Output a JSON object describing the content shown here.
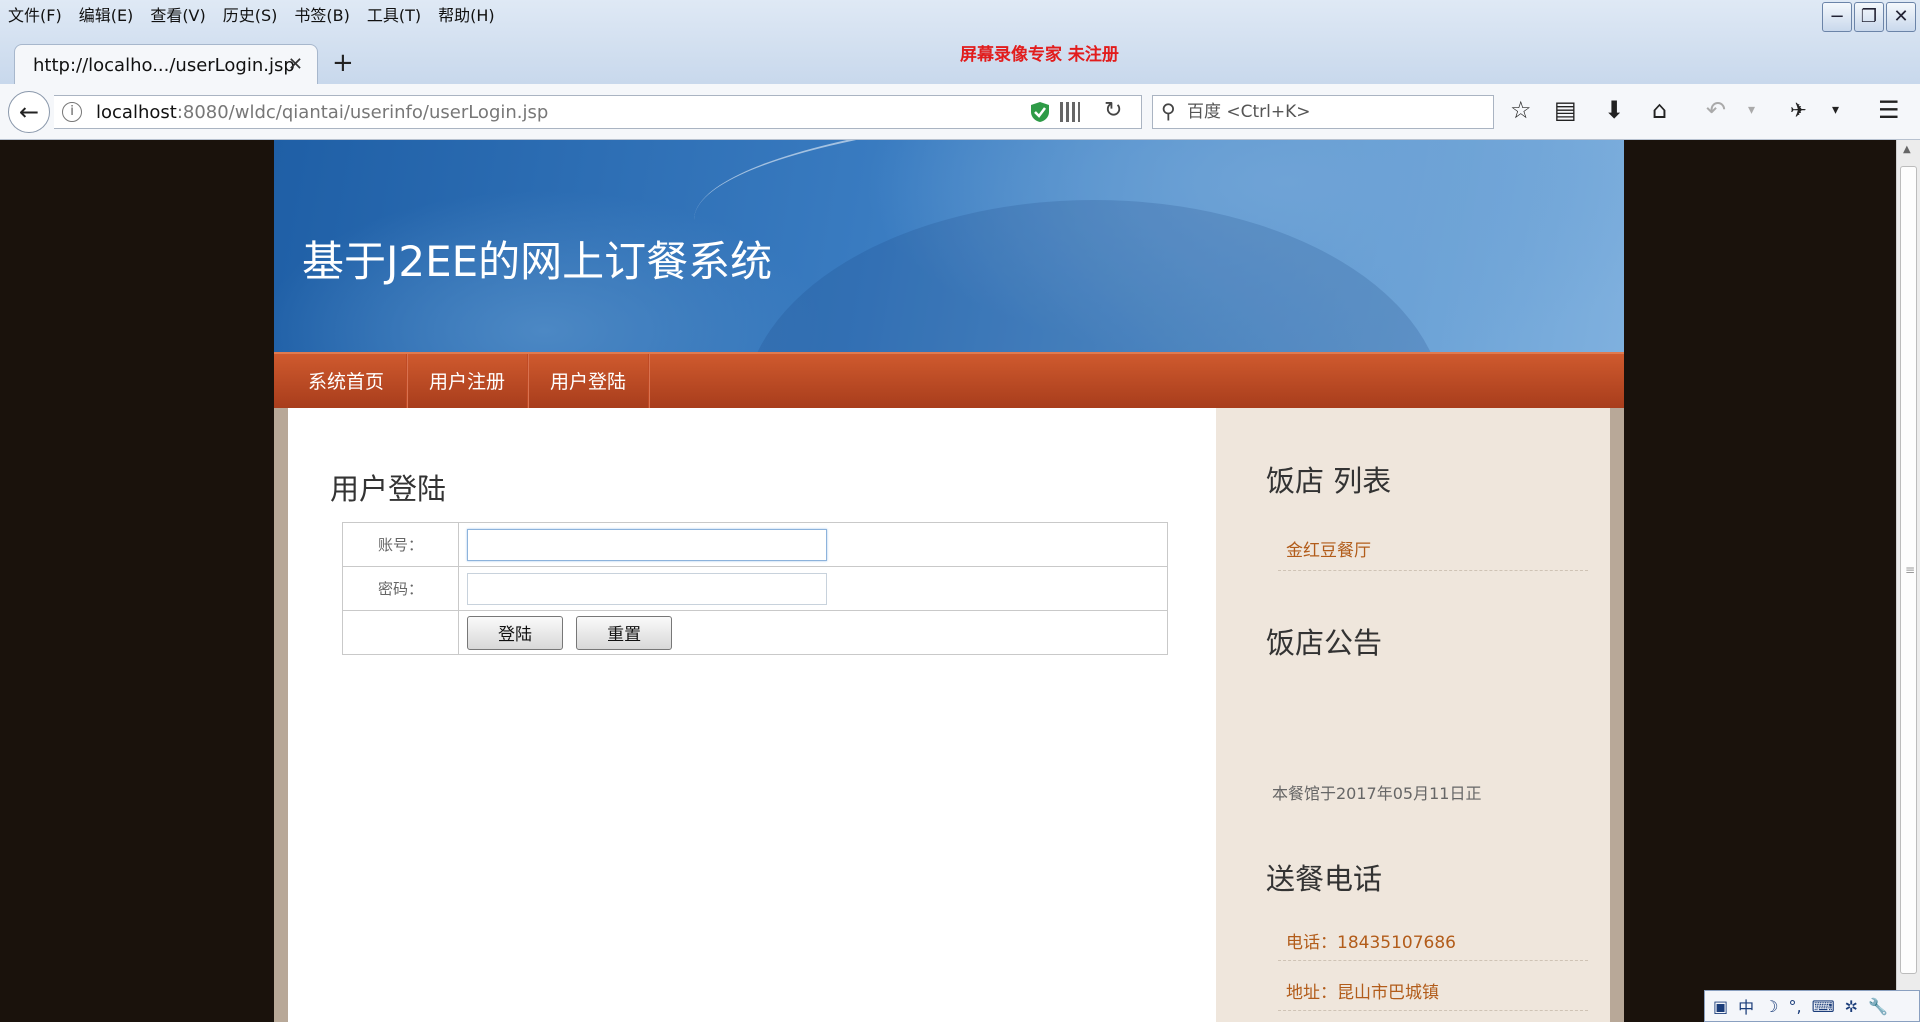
{
  "browser": {
    "menu": [
      "文件(F)",
      "编辑(E)",
      "查看(V)",
      "历史(S)",
      "书签(B)",
      "工具(T)",
      "帮助(H)"
    ],
    "watermark": "屏幕录像专家  未注册",
    "tab_title": "http://localho.../userLogin.jsp",
    "url_host": "localhost",
    "url_path": ":8080/wldc/qiantai/userinfo/userLogin.jsp",
    "search_placeholder": "百度 <Ctrl+K>"
  },
  "site": {
    "title": "基于J2EE的网上订餐系统",
    "nav": [
      "系统首页",
      "用户注册",
      "用户登陆"
    ]
  },
  "login": {
    "heading": "用户登陆",
    "account_label": "账号：",
    "password_label": "密码：",
    "account_value": "",
    "password_value": "",
    "login_button": "登陆",
    "reset_button": "重置"
  },
  "sidebar": {
    "restaurant_list_title": "饭店 列表",
    "restaurants": [
      "金红豆餐厅"
    ],
    "notice_title": "饭店公告",
    "notice_text": "本餐馆于2017年05月11日正",
    "delivery_title": "送餐电话",
    "phone": "电话：18435107686",
    "address": "地址：昆山市巴城镇"
  },
  "ime": {
    "mode": "中"
  },
  "colors": {
    "banner_blue": "#3a7cc1",
    "menu_orange": "#b84420",
    "link_brown": "#b25c1a",
    "watermark_red": "#e21c1c"
  }
}
